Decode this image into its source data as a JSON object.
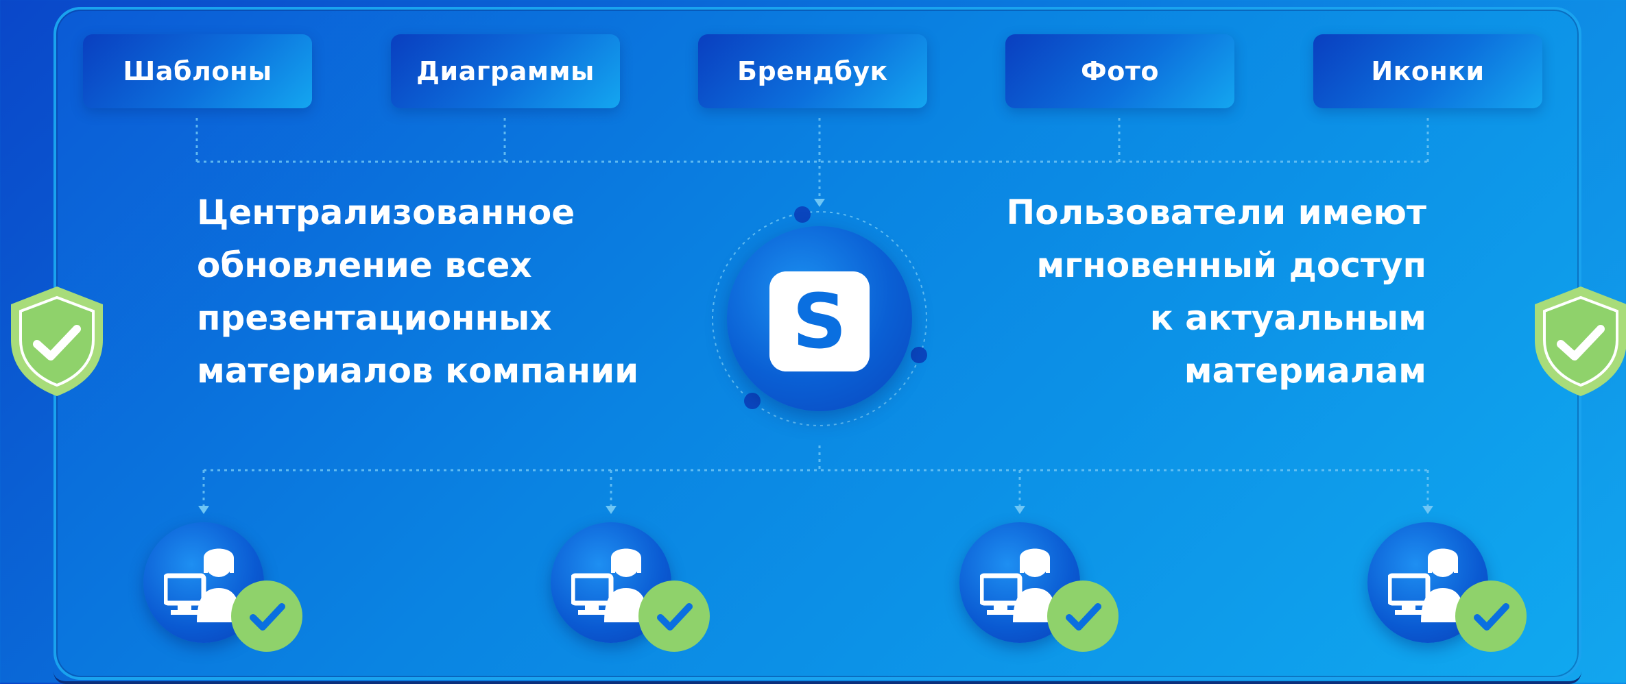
{
  "tabs": [
    {
      "label": "Шаблоны"
    },
    {
      "label": "Диаграммы"
    },
    {
      "label": "Брендбук"
    },
    {
      "label": "Фото"
    },
    {
      "label": "Иконки"
    }
  ],
  "left_text": "Централизованное\nобновление всех\nпрезентационных\nматериалов компании",
  "right_text": "Пользователи имеют\nмгновенный доступ\nк актуальным\nматериалам",
  "hub_logo": "S",
  "users": [
    {
      "icon": "user-workstation-icon",
      "status": "check-icon"
    },
    {
      "icon": "user-workstation-icon",
      "status": "check-icon"
    },
    {
      "icon": "user-workstation-icon",
      "status": "check-icon"
    },
    {
      "icon": "user-workstation-icon",
      "status": "check-icon"
    }
  ],
  "colors": {
    "accent_blue": "#0a6fe0",
    "check_green": "#8fd26b",
    "shield_green": "#a8dc7a",
    "connector": "#6fc6f5"
  }
}
